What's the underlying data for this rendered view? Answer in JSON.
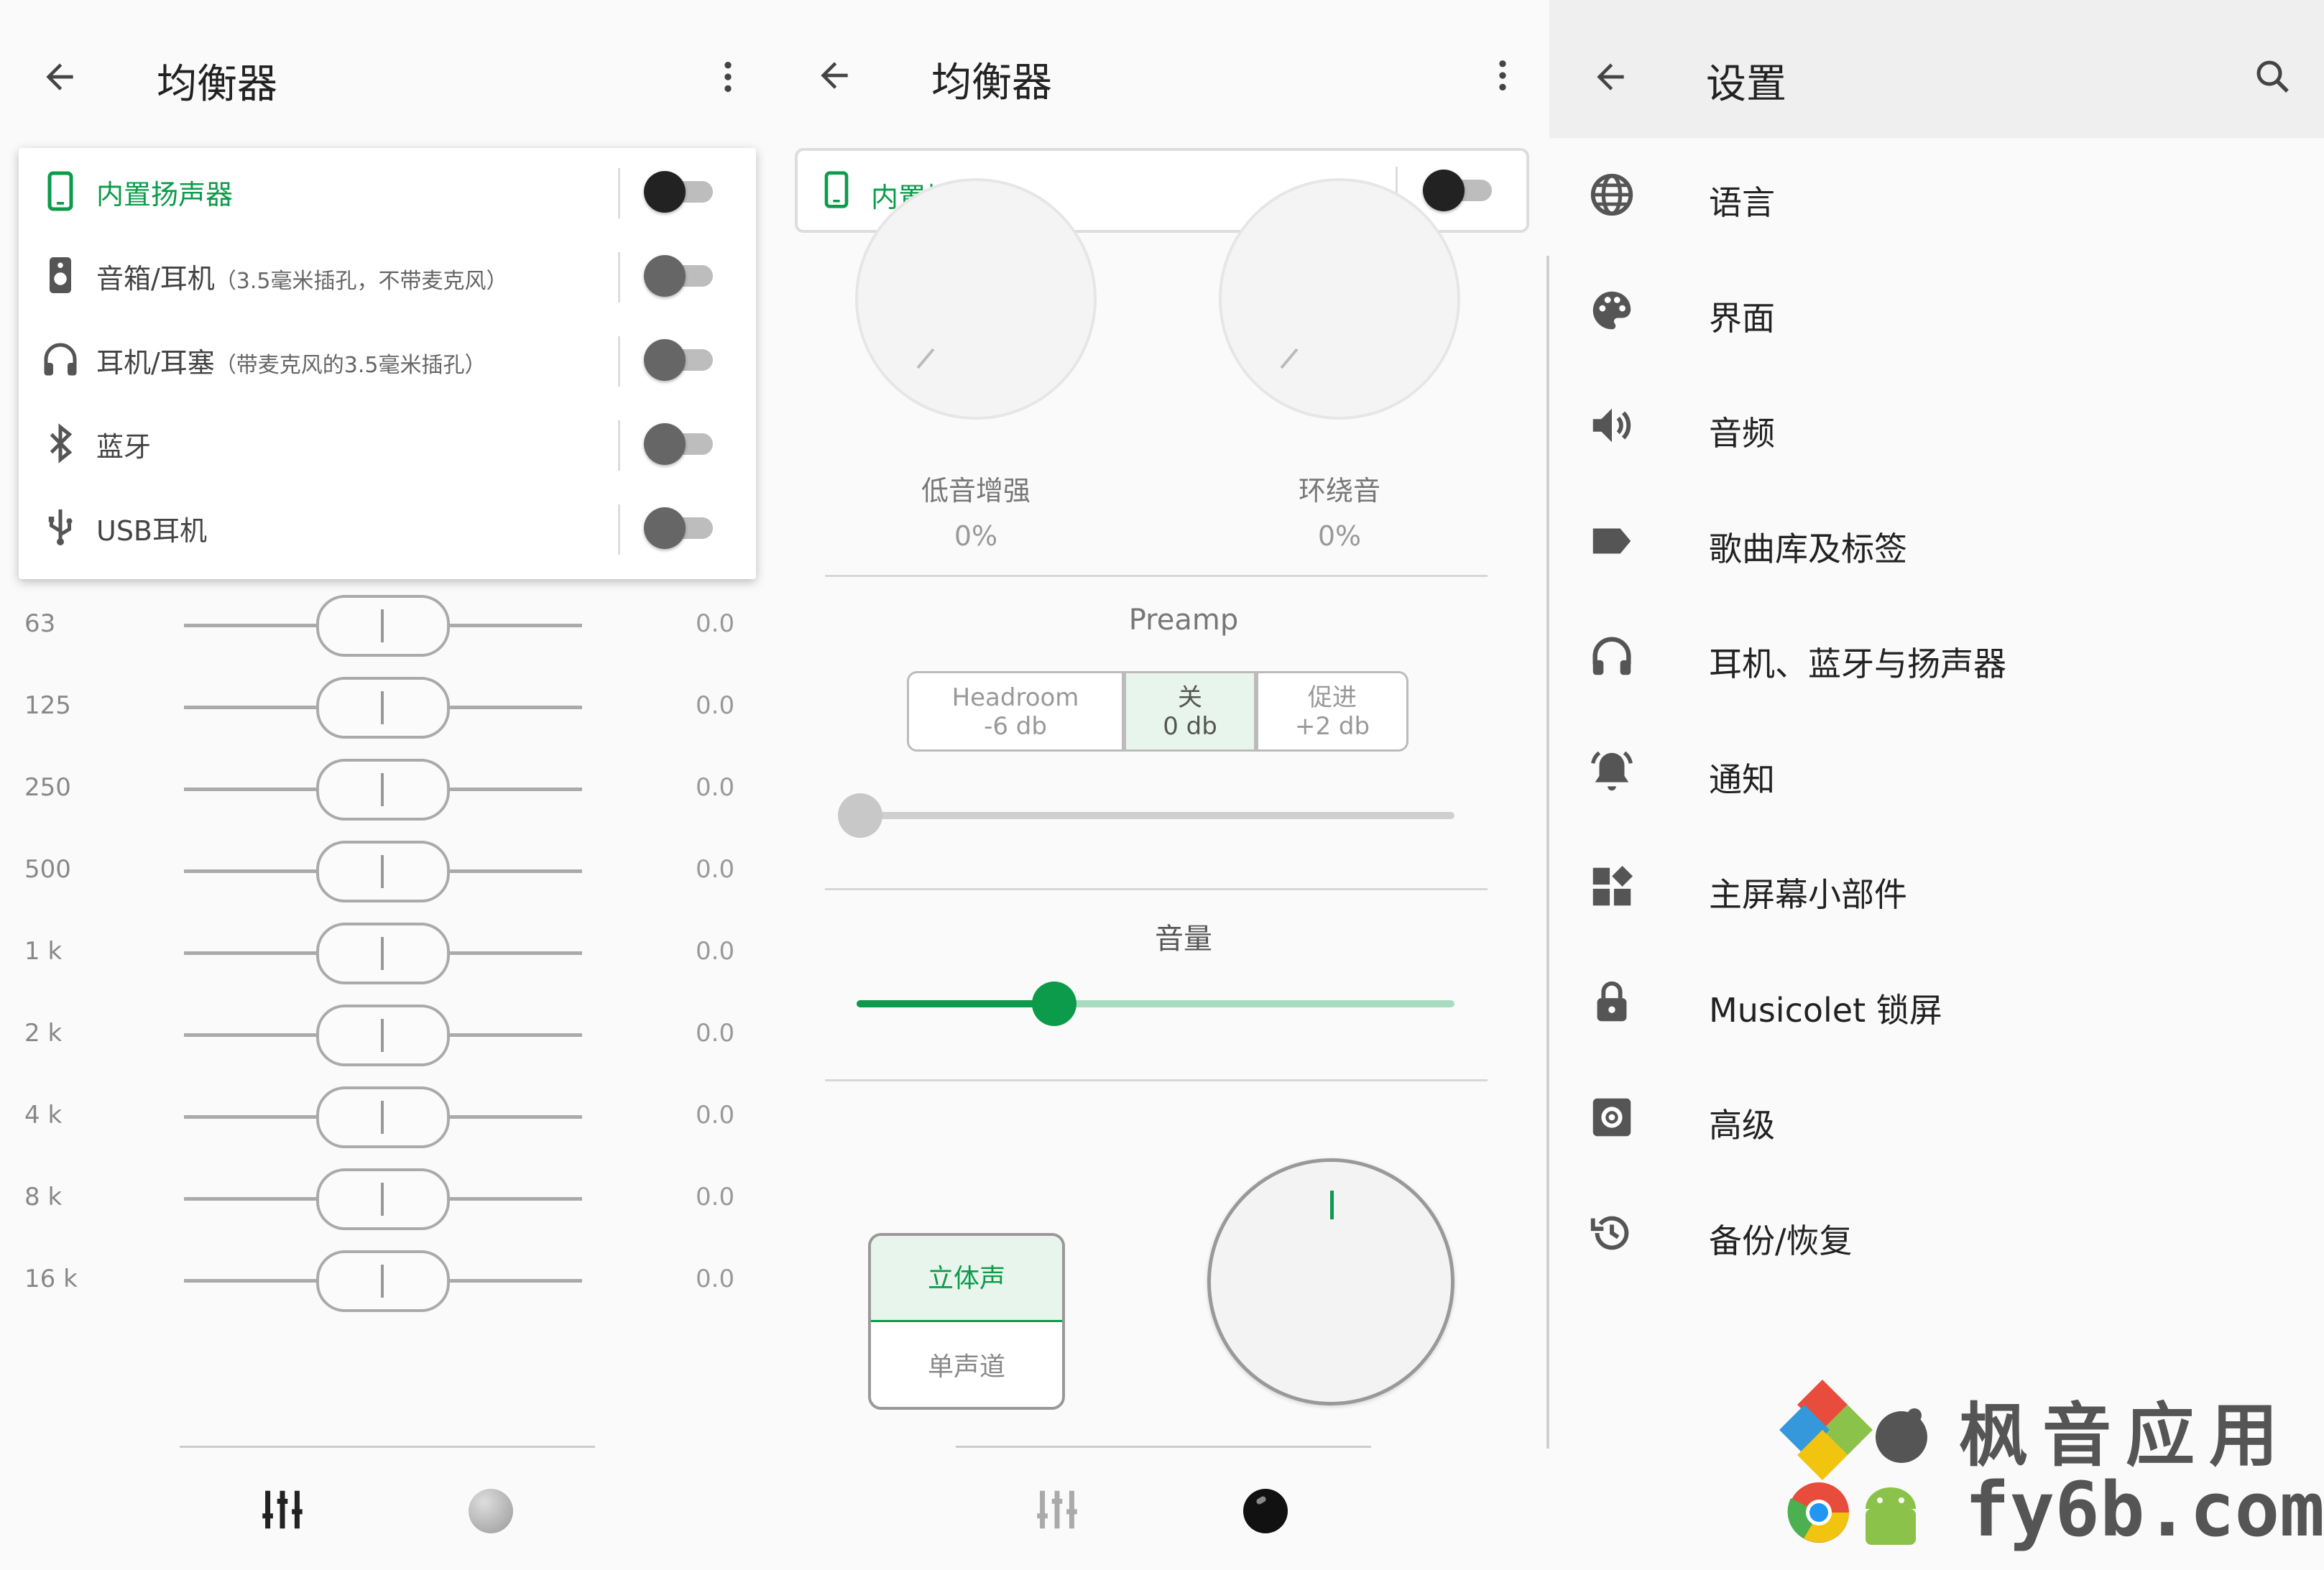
{
  "panel1": {
    "title": "均衡器",
    "devices": [
      {
        "label": "内置扬声器",
        "sub": "",
        "icon": "phone-icon",
        "active": true
      },
      {
        "label": "音箱/耳机",
        "sub": "（3.5毫米插孔，不带麦克风）",
        "icon": "speaker-icon",
        "active": false
      },
      {
        "label": "耳机/耳塞",
        "sub": "（带麦克风的3.5毫米插孔）",
        "icon": "headset-icon",
        "active": false
      },
      {
        "label": "蓝牙",
        "sub": "",
        "icon": "bluetooth-icon",
        "active": false
      },
      {
        "label": "USB耳机",
        "sub": "",
        "icon": "usb-icon",
        "active": false
      }
    ],
    "bands": [
      {
        "freq": "63",
        "value": "0.0"
      },
      {
        "freq": "125",
        "value": "0.0"
      },
      {
        "freq": "250",
        "value": "0.0"
      },
      {
        "freq": "500",
        "value": "0.0"
      },
      {
        "freq": "1 k",
        "value": "0.0"
      },
      {
        "freq": "2 k",
        "value": "0.0"
      },
      {
        "freq": "4 k",
        "value": "0.0"
      },
      {
        "freq": "8 k",
        "value": "0.0"
      },
      {
        "freq": "16 k",
        "value": "0.0"
      }
    ]
  },
  "panel2": {
    "title": "均衡器",
    "device_label": "内置扬声器",
    "bass_label": "低音增强",
    "bass_value": "0%",
    "surround_label": "环绕音",
    "surround_value": "0%",
    "preamp_title": "Preamp",
    "preamp_options": [
      {
        "line1": "Headroom",
        "line2": "-6 db",
        "selected": false
      },
      {
        "line1": "关",
        "line2": "0 db",
        "selected": true
      },
      {
        "line1": "促进",
        "line2": "+2 db",
        "selected": false
      }
    ],
    "preamp_level": 0,
    "volume_title": "音量",
    "volume_level": 0.33,
    "stereo_label": "立体声",
    "mono_label": "单声道"
  },
  "panel3": {
    "title": "设置",
    "items": [
      {
        "label": "语言",
        "icon": "globe-icon"
      },
      {
        "label": "界面",
        "icon": "palette-icon"
      },
      {
        "label": "音频",
        "icon": "volume-icon"
      },
      {
        "label": "歌曲库及标签",
        "icon": "label-icon"
      },
      {
        "label": "耳机、蓝牙与扬声器",
        "icon": "headphones-icon"
      },
      {
        "label": "通知",
        "icon": "bell-icon"
      },
      {
        "label": "主屏幕小部件",
        "icon": "widgets-icon"
      },
      {
        "label": "Musicolet 锁屏",
        "icon": "lock-icon"
      },
      {
        "label": "高级",
        "icon": "gear-icon"
      },
      {
        "label": "备份/恢复",
        "icon": "restore-icon"
      }
    ]
  },
  "watermark": {
    "brand": "枫音应用",
    "site": "fy6b.com"
  },
  "colors": {
    "accent": "#0b9b4a",
    "accent_light": "#a8dcc1",
    "selected_bg": "#e8f5ec"
  }
}
